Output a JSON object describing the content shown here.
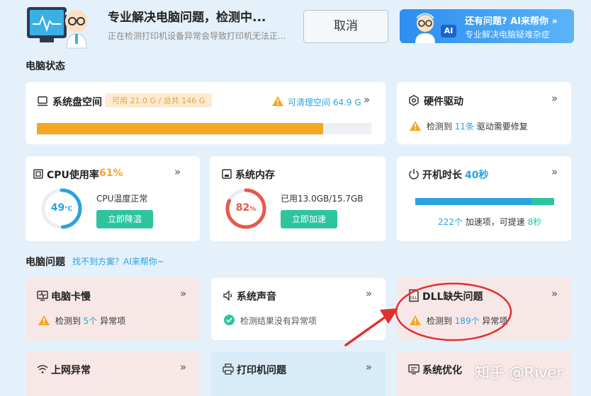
{
  "header": {
    "title": "专业解决电脑问题，检测中...",
    "subtitle": "正在检测打印机设备异常会导致打印机无法正...",
    "cancel_label": "取消",
    "ai_title": "还有问题? AI来帮你 »",
    "ai_subtitle": "专业解决电脑疑难杂症",
    "ai_badge": "AI"
  },
  "status_section": {
    "title": "电脑状态"
  },
  "disk": {
    "title": "系统盘空间",
    "badge": "可用 21.0 G / 总共 146 G",
    "cleanable": "可清理空间 64.9 G",
    "used_fraction": 0.8562
  },
  "driver": {
    "title": "硬件驱动",
    "prefix": "检测到",
    "count": "11条",
    "suffix": "驱动需要修复"
  },
  "cpu": {
    "title": "CPU使用率",
    "value": "61%",
    "temp": "49",
    "temp_unit": "℃",
    "note": "CPU温度正常",
    "button": "立即降温",
    "gauge_fraction": 0.49
  },
  "memory": {
    "title": "系统内存",
    "percent": "82",
    "percent_unit": "%",
    "note": "已用13.0GB/15.7GB",
    "button": "立即加速",
    "gauge_fraction": 0.82
  },
  "boot": {
    "title": "开机时长",
    "value": "40秒",
    "items": "222个",
    "items_label": "加速项，可提速",
    "save": "8秒",
    "blue_fraction": 0.836,
    "green_fraction": 0.164
  },
  "problems_section": {
    "title": "电脑问题",
    "help_link": "找不到方案？AI来帮你~"
  },
  "problems": [
    {
      "title": "电脑卡慢",
      "prefix": "检测到",
      "count": "5个",
      "suffix": "异常项"
    },
    {
      "title": "系统声音",
      "ok_text": "检测结果没有异常项"
    },
    {
      "title": "DLL缺失问题",
      "prefix": "检测到",
      "count": "189个",
      "suffix": "异常项"
    }
  ],
  "bottom_cards": [
    {
      "title": "上网异常"
    },
    {
      "title": "打印机问题"
    },
    {
      "title": "系统优化"
    }
  ],
  "chevron": "»",
  "watermark": "知乎 @River",
  "colors": {
    "accent": "#2aa3e0",
    "green": "#2ec4a0",
    "orange": "#f5a623",
    "red": "#e8584a",
    "annotation": "#e03030"
  }
}
